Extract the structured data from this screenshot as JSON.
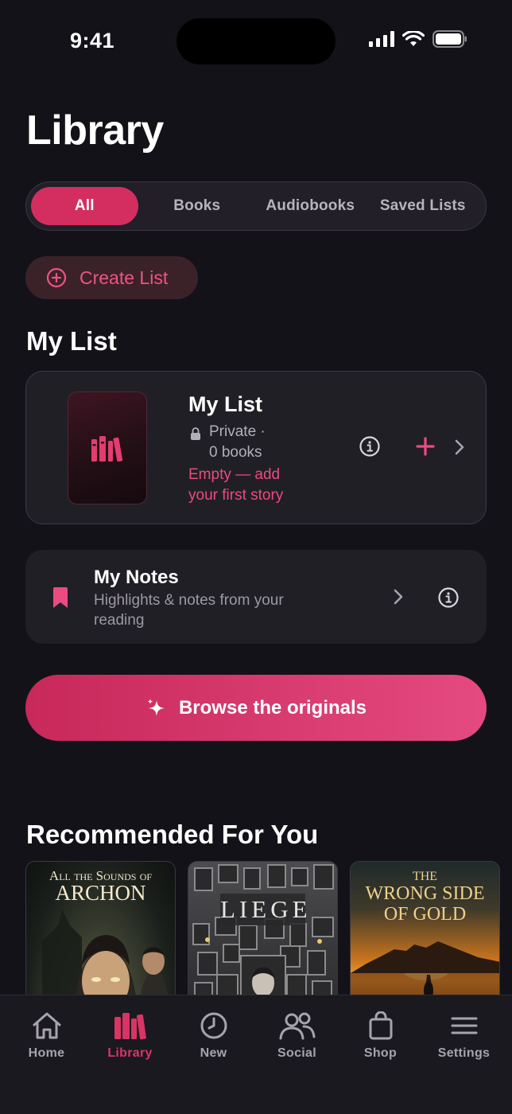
{
  "status": {
    "time": "9:41"
  },
  "page": {
    "title": "Library"
  },
  "filters": [
    {
      "label": "All",
      "active": true
    },
    {
      "label": "Books",
      "active": false
    },
    {
      "label": "Audiobooks",
      "active": false
    },
    {
      "label": "Saved Lists",
      "active": false
    }
  ],
  "create_list": {
    "label": "Create List"
  },
  "my_list_section": {
    "title": "My List",
    "card": {
      "name": "My List",
      "visibility": "Private ·",
      "count": "0 books",
      "empty_message": "Empty — add your first story"
    }
  },
  "notes": {
    "title": "My Notes",
    "subtitle": "Highlights & notes from your reading"
  },
  "browse": {
    "label": "Browse the originals"
  },
  "recommended": {
    "title": "Recommended For You",
    "books": [
      {
        "title_line1": "All the Sounds of",
        "title_line2": "ARCHON"
      },
      {
        "title_line1": "LIEGE"
      },
      {
        "title_line1": "THE",
        "title_line2": "WRONG SIDE",
        "title_line3": "OF GOLD"
      }
    ]
  },
  "tabs": [
    {
      "label": "Home",
      "icon": "home-icon",
      "active": false
    },
    {
      "label": "Library",
      "icon": "library-icon",
      "active": true
    },
    {
      "label": "New",
      "icon": "clock-icon",
      "active": false
    },
    {
      "label": "Social",
      "icon": "people-icon",
      "active": false
    },
    {
      "label": "Shop",
      "icon": "bag-icon",
      "active": false
    },
    {
      "label": "Settings",
      "icon": "menu-icon",
      "active": false
    }
  ],
  "colors": {
    "accent": "#d42e61",
    "background": "#141219",
    "card": "#211f26"
  }
}
